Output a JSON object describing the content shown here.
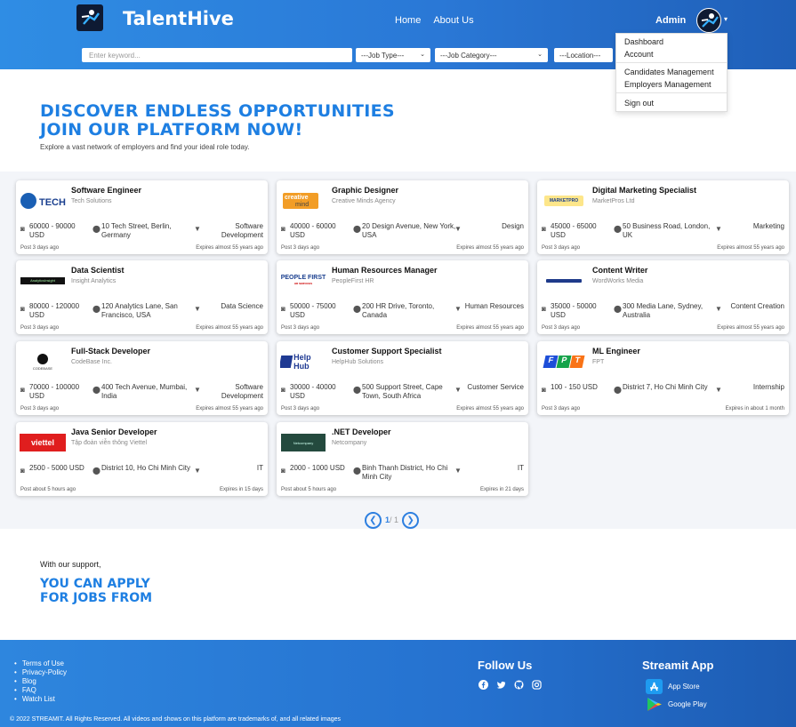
{
  "header": {
    "brand": "TalentHive",
    "nav": [
      "Home",
      "About Us"
    ],
    "user": "Admin",
    "search_placeholder": "Enter keyword...",
    "filters": [
      "---Job Type---",
      "---Job Category---",
      "---Location---"
    ]
  },
  "user_menu": {
    "items": [
      "Dashboard",
      "Account",
      "Candidates Management",
      "Employers Management",
      "Sign out"
    ]
  },
  "hero": {
    "line1": "DISCOVER ENDLESS OPPORTUNITIES",
    "line2": "JOIN OUR PLATFORM NOW!",
    "subtitle": "Explore a vast network of employers and find your ideal role today."
  },
  "jobs": [
    {
      "title": "Software Engineer",
      "company": "Tech Solutions",
      "logo": "TECH",
      "salary": "60000 - 90000 USD",
      "location": "10 Tech Street, Berlin, Germany",
      "category": "Software Development",
      "posted": "Post 3 days ago",
      "expires": "Expires almost 55 years ago"
    },
    {
      "title": "Graphic Designer",
      "company": "Creative Minds Agency",
      "logo": "creative mind",
      "salary": "40000 - 60000 USD",
      "location": "20 Design Avenue, New York, USA",
      "category": "Design",
      "posted": "Post 3 days ago",
      "expires": "Expires almost 55 years ago"
    },
    {
      "title": "Digital Marketing Specialist",
      "company": "MarketPros Ltd",
      "logo": "MARKETPRO",
      "salary": "45000 - 65000 USD",
      "location": "50 Business Road, London, UK",
      "category": "Marketing",
      "posted": "Post 3 days ago",
      "expires": "Expires almost 55 years ago"
    },
    {
      "title": "Data Scientist",
      "company": "Insight Analytics",
      "logo": "AnalyticsInsight",
      "salary": "80000 - 120000 USD",
      "location": "120 Analytics Lane, San Francisco, USA",
      "category": "Data Science",
      "posted": "Post 3 days ago",
      "expires": "Expires almost 55 years ago"
    },
    {
      "title": "Human Resources Manager",
      "company": "PeopleFirst HR",
      "logo": "PEOPLE FIRST",
      "salary": "50000 - 75000 USD",
      "location": "200 HR Drive, Toronto, Canada",
      "category": "Human Resources",
      "posted": "Post 3 days ago",
      "expires": "Expires almost 55 years ago"
    },
    {
      "title": "Content Writer",
      "company": "WordWorks Media",
      "logo": "WORDWORKS",
      "salary": "35000 - 50000 USD",
      "location": "300 Media Lane, Sydney, Australia",
      "category": "Content Creation",
      "posted": "Post 3 days ago",
      "expires": "Expires almost 55 years ago"
    },
    {
      "title": "Full-Stack Developer",
      "company": "CodeBase Inc.",
      "logo": "CODEBASE",
      "salary": "70000 - 100000 USD",
      "location": "400 Tech Avenue, Mumbai, India",
      "category": "Software Development",
      "posted": "Post 3 days ago",
      "expires": "Expires almost 55 years ago"
    },
    {
      "title": "Customer Support Specialist",
      "company": "HelpHub Solutions",
      "logo": "Help Hub",
      "salary": "30000 - 40000 USD",
      "location": "500 Support Street, Cape Town, South Africa",
      "category": "Customer Service",
      "posted": "Post 3 days ago",
      "expires": "Expires almost 55 years ago"
    },
    {
      "title": "ML Engineer",
      "company": "FPT",
      "logo": "FPT",
      "salary": "100 - 150 USD",
      "location": "District 7, Ho Chi Minh City",
      "category": "Internship",
      "posted": "Post 3 days ago",
      "expires": "Expires in about 1 month"
    },
    {
      "title": "Java Senior Developer",
      "company": "Tập đoàn viễn thông Viettel",
      "logo": "viettel",
      "salary": "2500 - 5000 USD",
      "location": "District 10, Ho Chi Minh City",
      "category": "IT",
      "posted": "Post about 5 hours ago",
      "expires": "Expires in 15 days"
    },
    {
      "title": ".NET Developer",
      "company": "Netcompany",
      "logo": "Netcompany",
      "salary": "2000 - 1000 USD",
      "location": "Binh Thanh District, Ho Chi Minh City",
      "category": "IT",
      "posted": "Post about 5 hours ago",
      "expires": "Expires in 21 days"
    }
  ],
  "pagination": {
    "current": "1",
    "total": "/ 1"
  },
  "support": {
    "intro": "With our support,",
    "line1": "YOU CAN APPLY",
    "line2": "FOR JOBS FROM"
  },
  "footer": {
    "links": [
      "Terms of Use",
      "Privacy-Policy",
      "Blog",
      "FAQ",
      "Watch List"
    ],
    "follow_title": "Follow Us",
    "social_icons": [
      "facebook-icon",
      "twitter-icon",
      "github-icon",
      "instagram-icon"
    ],
    "app_title": "Streamit App",
    "app_store": "App Store",
    "google_play": "Google Play",
    "copyright": "© 2022 STREAMIT. All Rights Reserved. All videos and shows on this platform are trademarks of, and all related images"
  },
  "colors": {
    "accent": "#1e7fe2",
    "header": "#2a78d6"
  }
}
